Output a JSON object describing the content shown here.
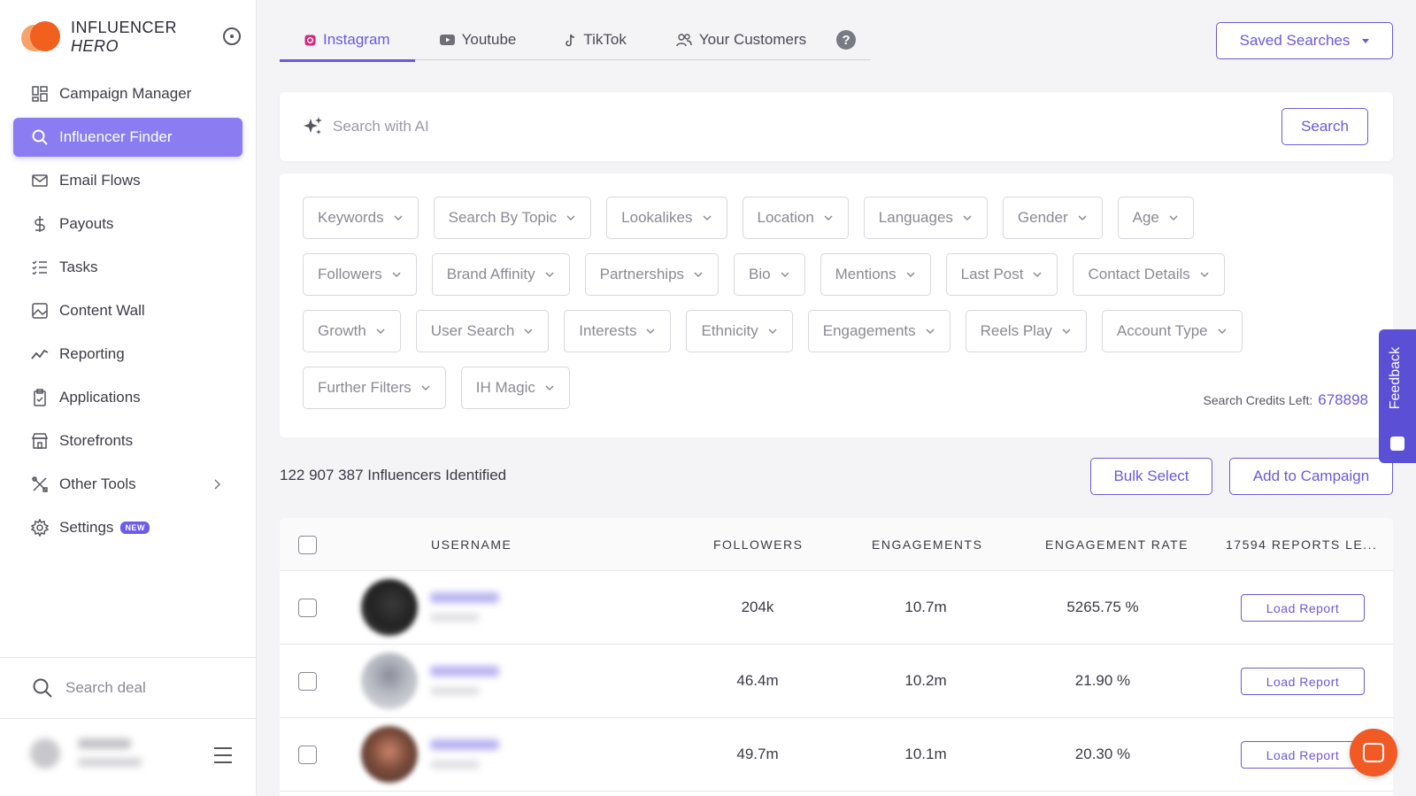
{
  "brand": {
    "line1": "INFLUENCER",
    "line2": "HERO"
  },
  "sidebar": {
    "items": [
      {
        "label": "Campaign Manager",
        "icon": "grid-icon"
      },
      {
        "label": "Influencer Finder",
        "icon": "search-icon",
        "active": true
      },
      {
        "label": "Email Flows",
        "icon": "mail-icon"
      },
      {
        "label": "Payouts",
        "icon": "dollar-icon"
      },
      {
        "label": "Tasks",
        "icon": "checklist-icon"
      },
      {
        "label": "Content Wall",
        "icon": "image-icon"
      },
      {
        "label": "Reporting",
        "icon": "trend-icon"
      },
      {
        "label": "Applications",
        "icon": "clipboard-icon"
      },
      {
        "label": "Storefronts",
        "icon": "store-icon"
      },
      {
        "label": "Other Tools",
        "icon": "tools-icon"
      },
      {
        "label": "Settings",
        "icon": "gear-icon",
        "badge": "NEW"
      }
    ],
    "search_placeholder": "Search deal"
  },
  "tabs": [
    {
      "label": "Instagram",
      "icon": "instagram-icon",
      "active": true
    },
    {
      "label": "Youtube",
      "icon": "youtube-icon"
    },
    {
      "label": "TikTok",
      "icon": "tiktok-icon"
    },
    {
      "label": "Your Customers",
      "icon": "users-icon"
    }
  ],
  "help_icon": "?",
  "saved_searches": "Saved Searches",
  "ai_search": {
    "placeholder": "Search with AI",
    "button": "Search"
  },
  "filters": {
    "row1": [
      "Keywords",
      "Search By Topic",
      "Lookalikes",
      "Location",
      "Languages",
      "Gender",
      "Age"
    ],
    "row2": [
      "Followers",
      "Brand Affinity",
      "Partnerships",
      "Bio",
      "Mentions",
      "Last Post",
      "Contact Details"
    ],
    "row3": [
      "Growth",
      "User Search",
      "Interests",
      "Ethnicity",
      "Engagements",
      "Reels Play",
      "Account Type"
    ],
    "row4": [
      "Further Filters",
      "IH Magic"
    ]
  },
  "credits": {
    "label": "Search Credits Left:",
    "value": "678898"
  },
  "results": {
    "identified": "122 907 387 Influencers Identified",
    "bulk_select": "Bulk Select",
    "add_to_campaign": "Add to Campaign"
  },
  "table": {
    "headers": [
      "USERNAME",
      "FOLLOWERS",
      "ENGAGEMENTS",
      "ENGAGEMENT RATE",
      "17594 REPORTS LE..."
    ],
    "rows": [
      {
        "followers": "204k",
        "engagements": "10.7m",
        "rate": "5265.75 %",
        "action": "Load Report"
      },
      {
        "followers": "46.4m",
        "engagements": "10.2m",
        "rate": "21.90 %",
        "action": "Load Report"
      },
      {
        "followers": "49.7m",
        "engagements": "10.1m",
        "rate": "20.30 %",
        "action": "Load Report"
      }
    ]
  },
  "feedback": "Feedback",
  "colors": {
    "accent": "#6b5ad9",
    "active_nav": "#8b7cf1",
    "brand_orange": "#f0601f"
  }
}
